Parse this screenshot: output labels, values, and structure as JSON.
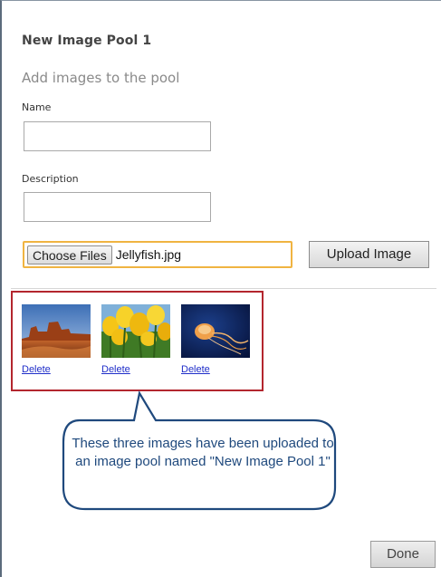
{
  "header": {
    "title": "New Image Pool 1",
    "subtitle": "Add images to the pool"
  },
  "form": {
    "name_label": "Name",
    "name_value": "",
    "description_label": "Description",
    "description_value": "",
    "choose_files_label": "Choose Files",
    "selected_file": "Jellyfish.jpg",
    "upload_label": "Upload Image"
  },
  "images": [
    {
      "icon": "desert-image",
      "delete_label": "Delete"
    },
    {
      "icon": "tulips-image",
      "delete_label": "Delete"
    },
    {
      "icon": "jellyfish-image",
      "delete_label": "Delete"
    }
  ],
  "callout": {
    "text": "These three images have been uploaded to an image pool named \"New Image Pool 1\""
  },
  "footer": {
    "done_label": "Done"
  },
  "colors": {
    "highlight_border": "#b3262e",
    "file_focus_border": "#f0b441",
    "callout_border": "#1f497d",
    "link": "#1f2ec9"
  }
}
